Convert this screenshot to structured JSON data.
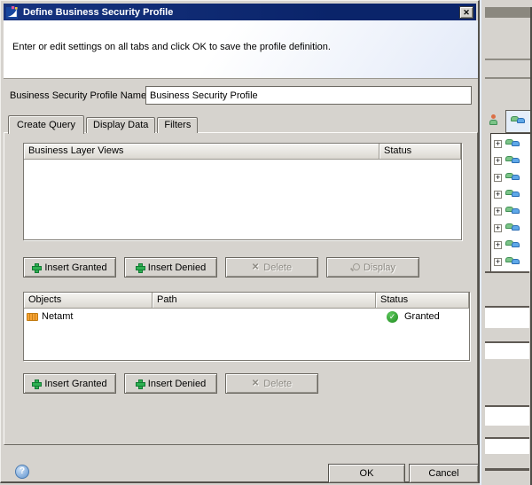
{
  "window": {
    "title": "Define Business Security Profile",
    "close_glyph": "✕"
  },
  "header": {
    "description": "Enter or edit settings on all tabs and click OK to save the profile definition."
  },
  "profile": {
    "name_label": "Business Security Profile Name",
    "name_value": "Business Security Profile"
  },
  "tabs": [
    {
      "label": "Create Query",
      "active": true
    },
    {
      "label": "Display Data",
      "active": false
    },
    {
      "label": "Filters",
      "active": false
    }
  ],
  "views_section": {
    "columns": [
      "Business Layer Views",
      "Status"
    ],
    "rows": [],
    "buttons": [
      {
        "label": "Insert Granted",
        "icon": "plus-icon",
        "enabled": true
      },
      {
        "label": "Insert Denied",
        "icon": "plus-icon",
        "enabled": true
      },
      {
        "label": "Delete",
        "icon": "x-icon",
        "enabled": false
      },
      {
        "label": "Display",
        "icon": "magnifier-icon",
        "enabled": false
      }
    ]
  },
  "objects_section": {
    "columns": [
      "Objects",
      "Path",
      "Status"
    ],
    "rows": [
      {
        "object": "Netamt",
        "object_icon": "measure-icon",
        "path": "",
        "status": "Granted",
        "status_icon": "granted-check-icon"
      }
    ],
    "buttons": [
      {
        "label": "Insert Granted",
        "icon": "plus-icon",
        "enabled": true
      },
      {
        "label": "Insert Denied",
        "icon": "plus-icon",
        "enabled": true
      },
      {
        "label": "Delete",
        "icon": "x-icon",
        "enabled": false
      }
    ]
  },
  "footer": {
    "help_glyph": "?",
    "ok_label": "OK",
    "cancel_label": "Cancel"
  },
  "background_panel": {
    "tree_expander_glyph": "+",
    "tree_row_count": 8,
    "toolbar_icons": [
      "user-icon",
      "user-group-icon"
    ]
  },
  "glyphs": {
    "delete_x": "✕",
    "check": "✓"
  },
  "colors": {
    "titlebar_blue": "#0a246a",
    "face_gray": "#d6d3ce",
    "insert_plus_green": "#2eb052",
    "granted_green": "#1f8b1f",
    "measure_orange": "#f7a233",
    "header_gradient_blue": "#e3eaf8"
  }
}
